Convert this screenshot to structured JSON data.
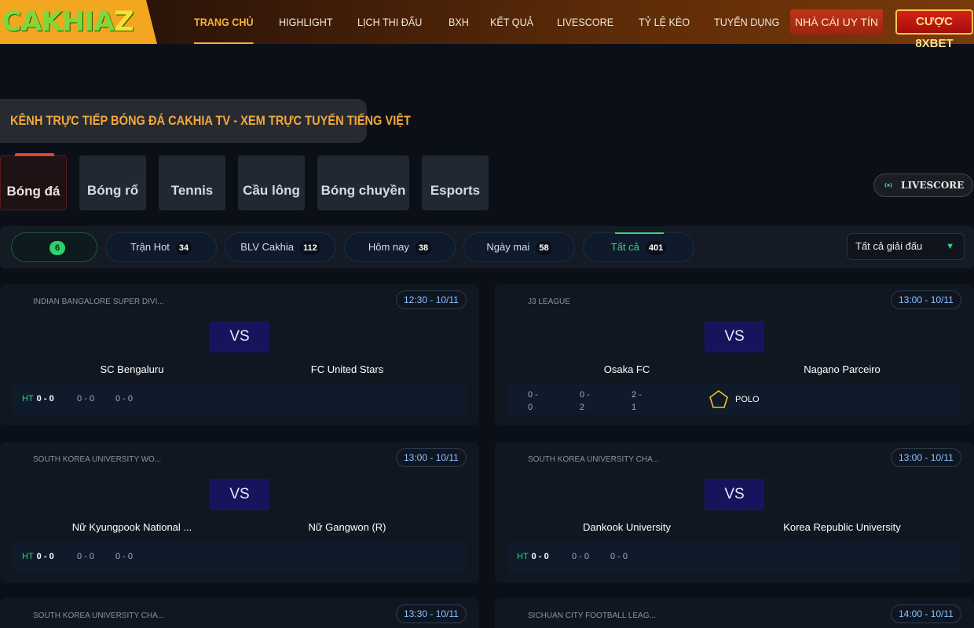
{
  "header": {
    "logo_main": "CAKHIA",
    "logo_z": "Z",
    "nav": [
      "TRANG CHỦ",
      "HIGHLIGHT",
      "LỊCH THI ĐẤU",
      "BXH",
      "KẾT QUẢ",
      "LIVESCORE",
      "TỶ LỆ KÈO",
      "TUYỂN DỤNG"
    ],
    "btn_trust": "NHÀ CÁI UY TÍN",
    "btn_8xbet": "CƯỢC 8XBET"
  },
  "page_title": "KÊNH TRỰC TIẾP BÓNG ĐÁ CAKHIA TV - XEM TRỰC TUYẾN TIẾNG VIỆT",
  "sports": [
    "Bóng đá",
    "Bóng rổ",
    "Tennis",
    "Cầu lông",
    "Bóng chuyền",
    "Esports"
  ],
  "livescore_label": "LIVESCORE",
  "filters": {
    "live_count": "6",
    "items": [
      {
        "label": "Trận Hot",
        "count": "34"
      },
      {
        "label": "BLV Cakhia",
        "count": "112"
      },
      {
        "label": "Hôm nay",
        "count": "38"
      },
      {
        "label": "Ngày mai",
        "count": "58"
      },
      {
        "label": "Tất cả",
        "count": "401"
      }
    ],
    "league_select": "Tất cả giải đấu"
  },
  "matches": [
    {
      "league": "INDIAN BANGALORE SUPER DIVI...",
      "time": "12:30 - 10/11",
      "vs": "VS",
      "home": "SC Bengaluru",
      "away": "FC United Stars",
      "ht_label": "HT",
      "ht": "0 - 0",
      "s1": "0 - 0",
      "s2": "0 - 0"
    },
    {
      "league": "J3 LEAGUE",
      "time": "13:00 - 10/11",
      "vs": "VS",
      "home": "Osaka FC",
      "away": "Nagano Parceiro",
      "c1a": "0 -",
      "c1b": "0",
      "c2a": "0 -",
      "c2b": "2",
      "c3a": "2 -",
      "c3b": "1",
      "polo": "POLO"
    },
    {
      "league": "SOUTH KOREA UNIVERSITY WO...",
      "time": "13:00 - 10/11",
      "vs": "VS",
      "home": "Nữ Kyungpook National ...",
      "away": "Nữ Gangwon (R)",
      "ht_label": "HT",
      "ht": "0 - 0",
      "s1": "0 - 0",
      "s2": "0 - 0"
    },
    {
      "league": "SOUTH KOREA UNIVERSITY CHA...",
      "time": "13:00 - 10/11",
      "vs": "VS",
      "home": "Dankook University",
      "away": "Korea Republic University",
      "ht_label": "HT",
      "ht": "0 - 0",
      "s1": "0 - 0",
      "s2": "0 - 0"
    },
    {
      "league": "SOUTH KOREA UNIVERSITY CHA...",
      "time": "13:30 - 10/11"
    },
    {
      "league": "SICHUAN CITY FOOTBALL LEAG...",
      "time": "14:00 - 10/11"
    }
  ]
}
